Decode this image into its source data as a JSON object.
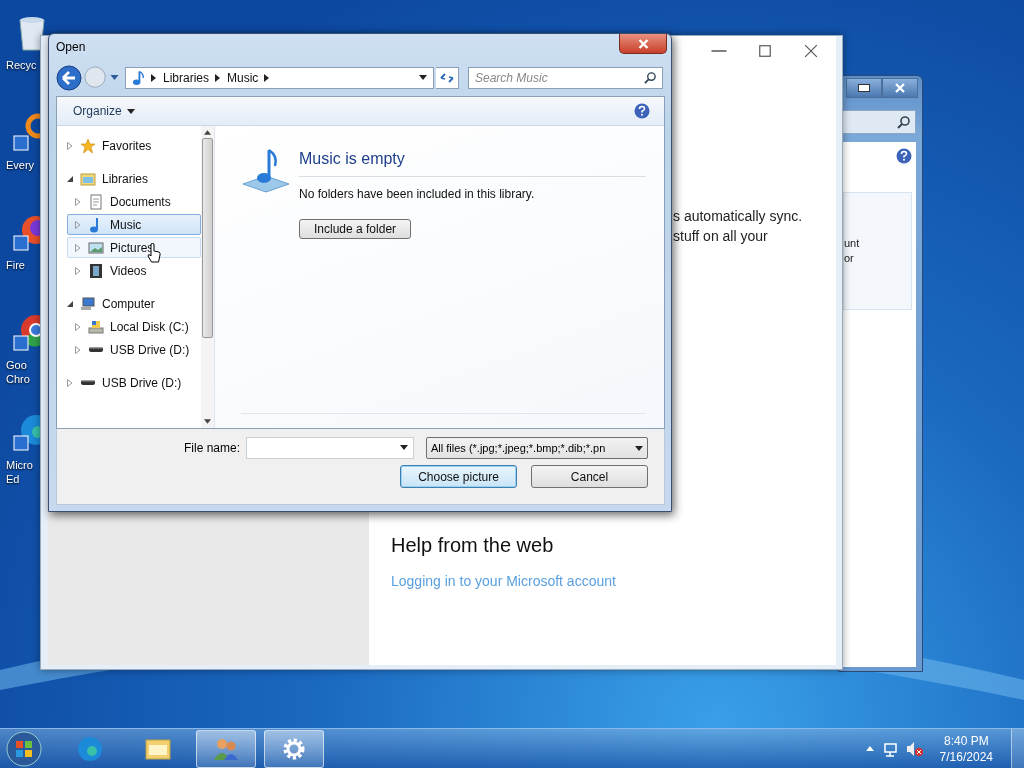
{
  "desktop_icons": [
    {
      "kind": "bin",
      "lines": [
        "Recyc"
      ]
    },
    {
      "kind": "ring",
      "lines": [
        "Every"
      ]
    },
    {
      "kind": "fox",
      "lines": [
        "Fire"
      ]
    },
    {
      "kind": "chrome",
      "lines": [
        "Goo",
        "Chro"
      ]
    },
    {
      "kind": "edge",
      "lines": [
        "Micro",
        "Ed"
      ]
    }
  ],
  "back_window": {
    "text_lines": [
      "s automatically sync.",
      "stuff on all your"
    ],
    "help_heading": "Help from the web",
    "help_link": "Logging in to your Microsoft account"
  },
  "side_window": {
    "box_lines": [
      "unt",
      "or"
    ]
  },
  "dialog": {
    "title": "Open",
    "breadcrumb": [
      "Libraries",
      "Music"
    ],
    "search": {
      "placeholder": "Search Music"
    },
    "toolbar": {
      "organize": "Organize"
    },
    "nav_tree": [
      {
        "kind": "star",
        "label": "Favorites",
        "expanded": false,
        "selected": false,
        "hovered": false
      },
      {
        "kind": "library",
        "label": "Libraries",
        "expanded": true,
        "selected": false,
        "hovered": false,
        "children": [
          {
            "kind": "document",
            "label": "Documents",
            "expanded": false,
            "selected": false,
            "hovered": false
          },
          {
            "kind": "music",
            "label": "Music",
            "expanded": false,
            "selected": true,
            "hovered": false
          },
          {
            "kind": "picture",
            "label": "Pictures",
            "expanded": false,
            "selected": false,
            "hovered": true
          },
          {
            "kind": "video",
            "label": "Videos",
            "expanded": false,
            "selected": false,
            "hovered": false
          }
        ]
      },
      {
        "kind": "computer",
        "label": "Computer",
        "expanded": true,
        "selected": false,
        "hovered": false,
        "children": [
          {
            "kind": "disk",
            "label": "Local Disk (C:)",
            "expanded": false,
            "selected": false,
            "hovered": false
          },
          {
            "kind": "usb",
            "label": "USB Drive (D:)",
            "expanded": false,
            "selected": false,
            "hovered": false
          }
        ]
      },
      {
        "kind": "usb",
        "label": "USB Drive (D:)",
        "expanded": false,
        "selected": false,
        "hovered": false
      }
    ],
    "content": {
      "heading": "Music is empty",
      "message": "No folders have been included in this library.",
      "button": "Include a folder"
    },
    "file_name": {
      "label": "File name:"
    },
    "file_type": "All files (*.jpg;*.jpeg;*.bmp;*.dib;*.pn",
    "buttons": [
      {
        "label": "Choose picture",
        "default": true
      },
      {
        "label": "Cancel",
        "default": false
      }
    ]
  },
  "taskbar": {
    "items": [
      {
        "kind": "edge",
        "active": false
      },
      {
        "kind": "folder",
        "active": false
      },
      {
        "kind": "users",
        "active": true
      },
      {
        "kind": "gear",
        "active": true
      }
    ],
    "clock": {
      "time": "8:40 PM",
      "date": "7/16/2024"
    }
  }
}
